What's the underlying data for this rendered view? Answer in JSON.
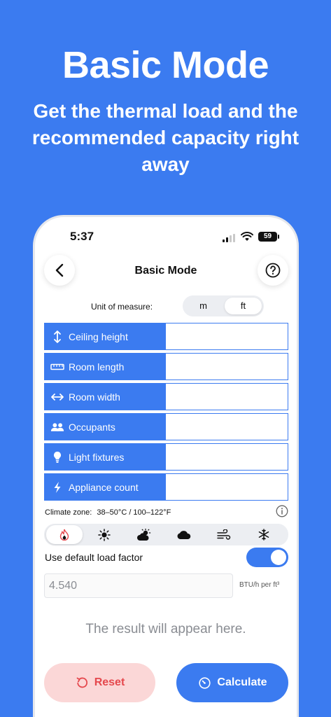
{
  "hero": {
    "title": "Basic Mode",
    "subtitle": "Get the thermal load and the recommended capacity right away"
  },
  "status_bar": {
    "time": "5:37",
    "battery": "59"
  },
  "nav": {
    "title": "Basic Mode",
    "back_icon": "chevron-left-icon",
    "help_icon": "question-circle-icon"
  },
  "unit": {
    "label": "Unit of measure:",
    "options": [
      "m",
      "ft"
    ],
    "selected": "ft"
  },
  "fields": [
    {
      "label": "Ceiling height",
      "icon": "vertical-arrows-icon",
      "value": ""
    },
    {
      "label": "Room length",
      "icon": "ruler-icon",
      "value": ""
    },
    {
      "label": "Room width",
      "icon": "horizontal-arrows-icon",
      "value": ""
    },
    {
      "label": "Occupants",
      "icon": "people-icon",
      "value": ""
    },
    {
      "label": "Light fixtures",
      "icon": "lightbulb-icon",
      "value": ""
    },
    {
      "label": "Appliance count",
      "icon": "bolt-icon",
      "value": ""
    }
  ],
  "climate": {
    "label": "Climate zone:",
    "value": "38–50°C / 100–122°F",
    "zones": [
      "flame-icon",
      "sun-icon",
      "sun-cloud-icon",
      "cloud-icon",
      "wind-icon",
      "snowflake-icon"
    ],
    "selected_index": 0
  },
  "load_factor": {
    "toggle_label": "Use default load factor",
    "toggle_on": true,
    "value": "4.540",
    "unit": "BTU/h per ft³"
  },
  "result_text": "The result will appear here.",
  "buttons": {
    "reset": "Reset",
    "calculate": "Calculate"
  },
  "colors": {
    "primary": "#3b7bf0",
    "reset_bg": "#fbd7d7",
    "reset_fg": "#e5484d"
  }
}
